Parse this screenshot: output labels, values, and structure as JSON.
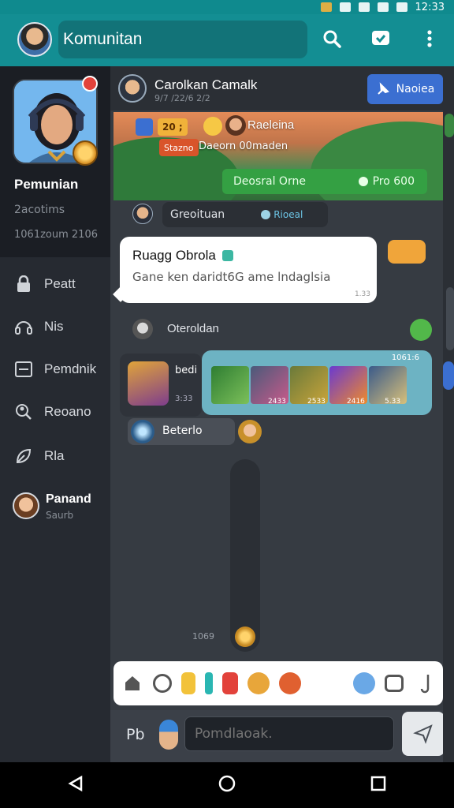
{
  "status_bar": {
    "time": "12:33"
  },
  "app_bar": {
    "title": "Komunitan",
    "icons": [
      "search-icon",
      "chat-icon",
      "more-vert-icon"
    ]
  },
  "sidebar": {
    "profile": {
      "name": "Pemunian",
      "sub1": "2acotims",
      "sub2": "1061zoum 2106"
    },
    "items": [
      {
        "label": "Peatt",
        "icon": "lock-icon"
      },
      {
        "label": "Nis",
        "icon": "headset-icon"
      },
      {
        "label": "Pemdnik",
        "icon": "list-icon"
      },
      {
        "label": "Reoano",
        "icon": "search-person-icon"
      },
      {
        "label": "Rla",
        "icon": "leaf-icon"
      }
    ],
    "user": {
      "name": "Panand",
      "sub": "Saurb"
    }
  },
  "chat": {
    "header": {
      "name": "Carolkan Camalk",
      "status": "9/7 /22/6 2/2",
      "action": "Naoiea"
    },
    "banner": {
      "chip1": "20 ;",
      "title": "Raeleina",
      "chip2": "Stazno",
      "sub": "Daeorn 00maden",
      "green_left": "Deosral Orne",
      "green_right": "Pro 600"
    },
    "msg1": {
      "label": "Greoituan",
      "tag": "Rioeal"
    },
    "bubble": {
      "title": "Ruagg Obrola",
      "body": "Gane ken daridt6G ame lndaglsia",
      "meta": "1.33"
    },
    "msg2": {
      "label": "Oteroldan"
    },
    "media": {
      "left_label": "bedi",
      "left_meta": "3:33",
      "count": "1061:6",
      "captions": [
        "2433",
        "2533",
        "2416",
        "",
        "5.33"
      ]
    },
    "msg3": {
      "label": "Beterlo"
    },
    "scroll_label": "1069",
    "composer": {
      "prefix": "Pb",
      "placeholder": "Pomdlaoak."
    }
  },
  "colors": {
    "teal": "#138e93",
    "sidebar": "#262a31",
    "chat_bg": "#363b42",
    "accent_blue": "#3b6fd1",
    "green": "#34a043"
  }
}
